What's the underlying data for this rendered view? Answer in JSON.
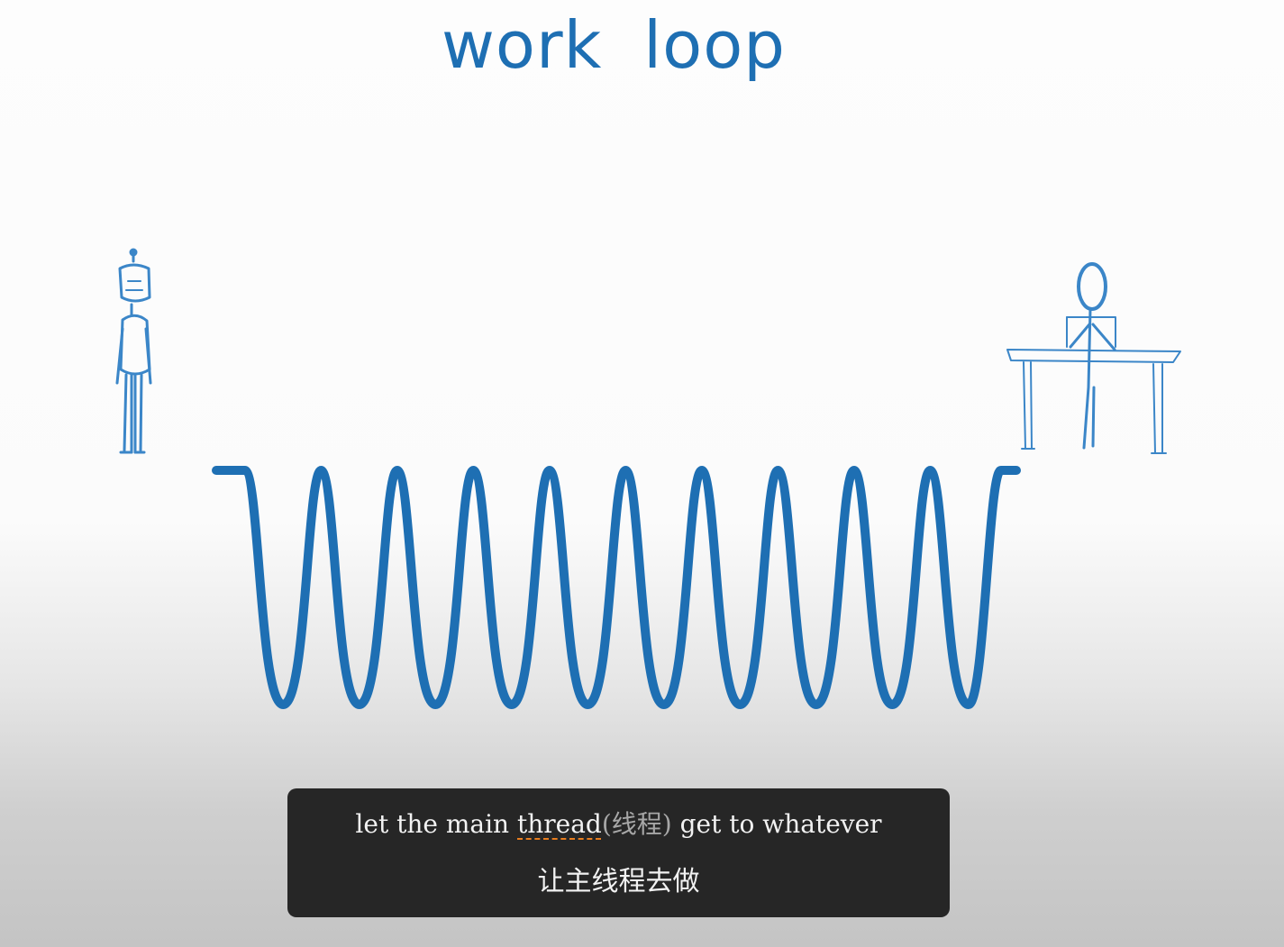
{
  "video": {
    "title": "work loop",
    "colors": {
      "ink": "#1e6fb3",
      "ink_light": "#3b86c8",
      "subtitle_bg": "#262626",
      "highlight": "#e87d1e"
    }
  },
  "subtitle": {
    "en_before": "let the main ",
    "en_highlight": "thread",
    "en_gloss": "(线程)",
    "en_after": " get to whatever",
    "zh": "让主线程去做"
  }
}
